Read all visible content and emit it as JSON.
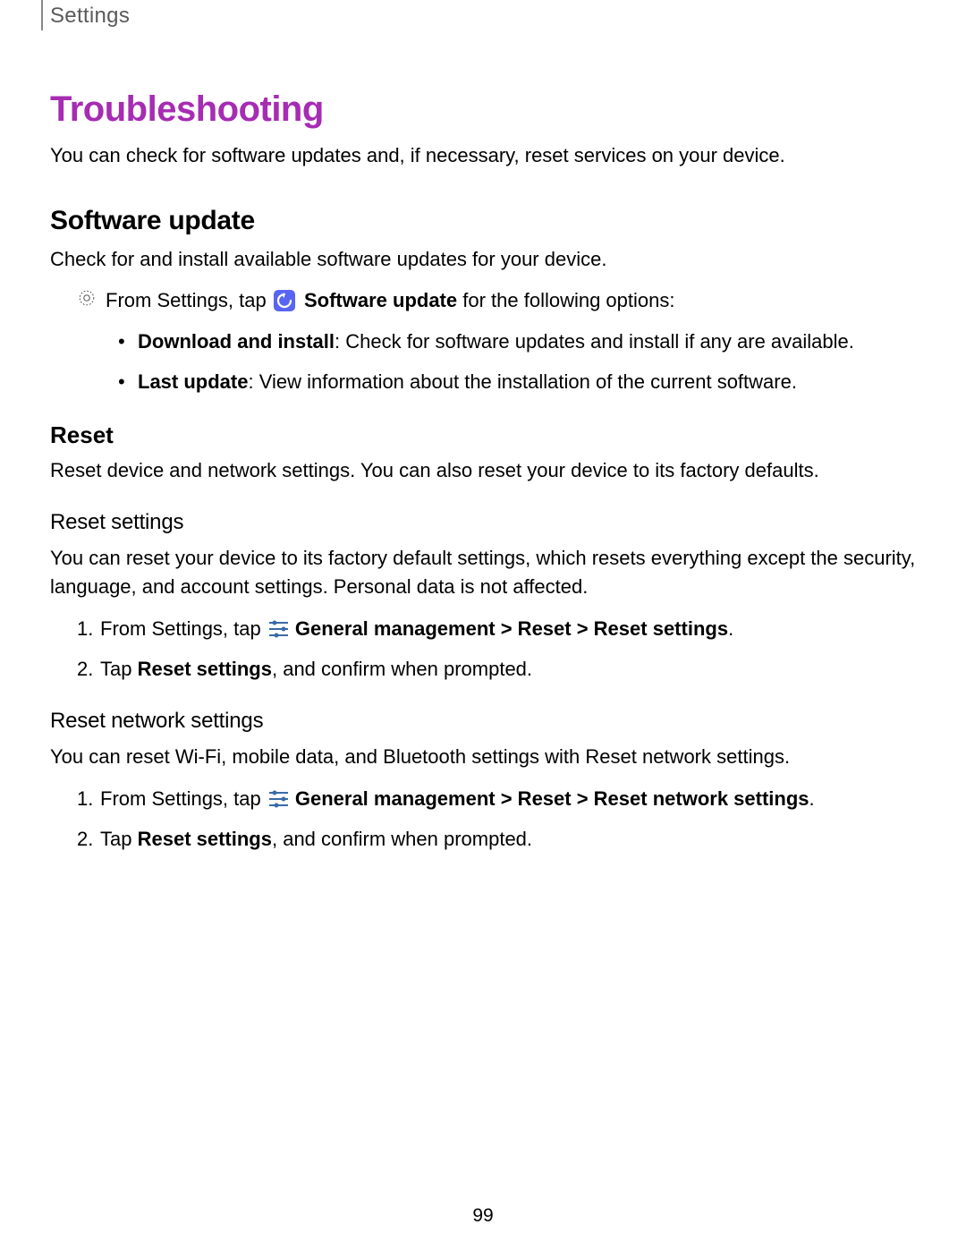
{
  "header": {
    "breadcrumb": "Settings"
  },
  "title": "Troubleshooting",
  "intro": "You can check for software updates and, if necessary, reset services on your device.",
  "software_update": {
    "heading": "Software update",
    "desc": "Check for and install available software updates for your device.",
    "step_prefix": "From Settings, tap ",
    "step_bold": "Software update",
    "step_suffix": " for the following options:",
    "items": [
      {
        "label": "Download and install",
        "desc": ": Check for software updates and install if any are available."
      },
      {
        "label": "Last update",
        "desc": ": View information about the installation of the current software."
      }
    ]
  },
  "reset": {
    "heading": "Reset",
    "desc": "Reset device and network settings. You can also reset your device to its factory defaults.",
    "reset_settings": {
      "heading": "Reset settings",
      "desc": "You can reset your device to its factory default settings, which resets everything except the security, language, and account settings. Personal data is not affected.",
      "step1_prefix": "From Settings, tap ",
      "step1_bold": "General management > Reset > Reset settings",
      "step1_suffix": ".",
      "step2_prefix": "Tap ",
      "step2_bold": "Reset settings",
      "step2_suffix": ", and confirm when prompted."
    },
    "reset_network": {
      "heading": "Reset network settings",
      "desc": "You can reset Wi-Fi, mobile data, and Bluetooth settings with Reset network settings.",
      "step1_prefix": "From Settings, tap ",
      "step1_bold": "General management > Reset > Reset network settings",
      "step1_suffix": ".",
      "step2_prefix": "Tap ",
      "step2_bold": "Reset settings",
      "step2_suffix": ", and confirm when prompted."
    }
  },
  "page_number": "99"
}
